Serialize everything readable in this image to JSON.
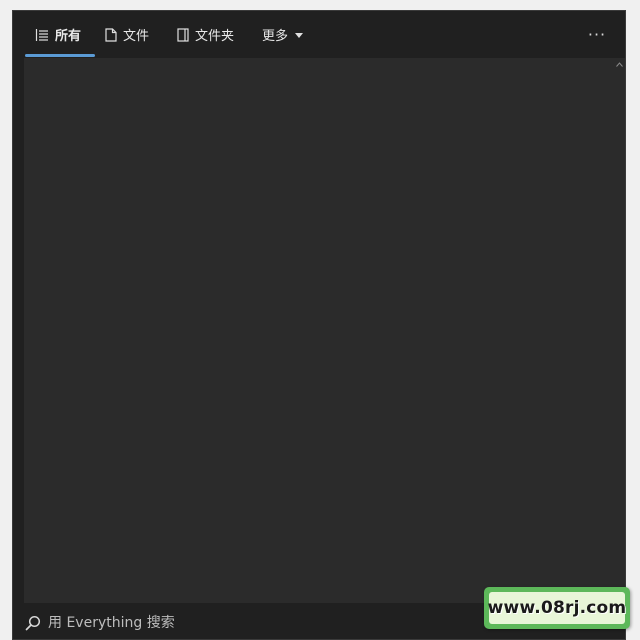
{
  "tabs": [
    {
      "label": "所有",
      "icon": "list-icon",
      "active": true
    },
    {
      "label": "文件",
      "icon": "file-icon",
      "active": false
    },
    {
      "label": "文件夹",
      "icon": "folder-icon",
      "active": false
    },
    {
      "label": "更多",
      "icon": "chevron-down-icon",
      "active": false
    }
  ],
  "more_menu": {
    "label": "···",
    "icon": "more-horizontal-icon"
  },
  "search": {
    "placeholder": "用 Everything 搜索",
    "value": "",
    "icon": "search-icon"
  },
  "watermark": {
    "text": "www.08rj.com"
  },
  "colors": {
    "window_bg": "#202020",
    "content_bg": "#2b2b2b",
    "accent": "#5b9bd5",
    "text": "#e8e8e8",
    "watermark_green": "#5db85a"
  }
}
